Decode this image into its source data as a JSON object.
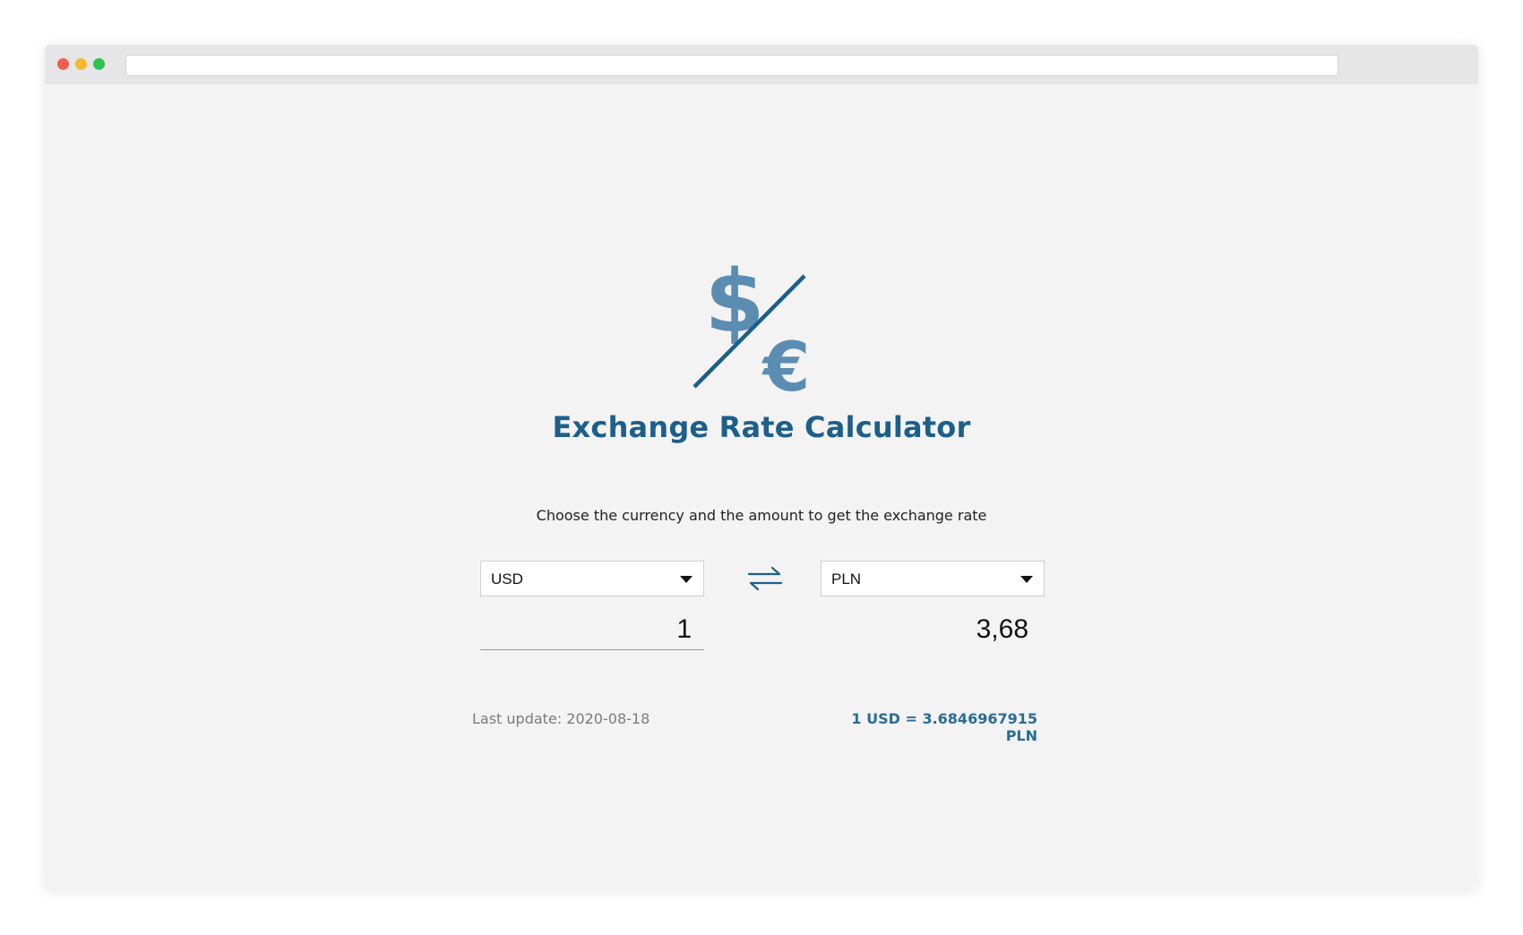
{
  "app": {
    "title": "Exchange Rate Calculator",
    "subtitle": "Choose the currency and the amount to get the exchange rate"
  },
  "logo": {
    "icon": "dollar-euro-icon",
    "dollar_glyph": "$",
    "euro_glyph": "€"
  },
  "converter": {
    "from_currency": "USD",
    "to_currency": "PLN",
    "amount": "1",
    "result": "3,68",
    "swap_icon": "swap-arrows-icon"
  },
  "footer": {
    "last_update": "Last update: 2020-08-18",
    "rate_text": "1 USD = 3.6846967915 PLN"
  },
  "colors": {
    "accent": "#1d5f8a",
    "logo": "#5b8db3",
    "rate": "#2a6c98",
    "background": "#f3f3f3"
  }
}
